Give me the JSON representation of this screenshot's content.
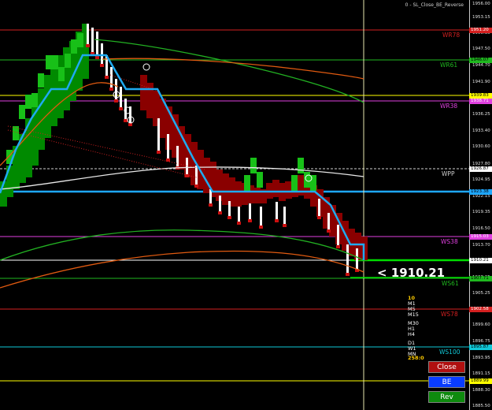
{
  "window": {
    "indicator_title": "0 - SL_Close_BE_Reverse"
  },
  "price_scale": {
    "ticks": [
      "1956.00",
      "1953.15",
      "1950.35",
      "1947.50",
      "1944.70",
      "1941.90",
      "1939.05",
      "1936.25",
      "1933.40",
      "1930.60",
      "1927.80",
      "1924.95",
      "1922.15",
      "1919.35",
      "1916.50",
      "1913.70",
      "1910.85",
      "1908.05",
      "1905.25",
      "1902.40",
      "1899.60",
      "1896.75",
      "1893.95",
      "1891.15",
      "1888.30",
      "1885.50"
    ]
  },
  "levels": [
    {
      "label": "WR78",
      "tag": "1951.20",
      "color": "#d42020",
      "tag_bg": "#d42020",
      "tag_fg": "#ffffff"
    },
    {
      "label": "WR61",
      "tag": "1946.07",
      "color": "#1fb81f",
      "tag_bg": "#1fb81f",
      "tag_fg": "#000000"
    },
    {
      "label": "",
      "tag": "1939.83",
      "color": "#ffff00",
      "tag_bg": "#ffff00",
      "tag_fg": "#000000"
    },
    {
      "label": "WR38",
      "tag": "1938.71",
      "color": "#e040e0",
      "tag_bg": "#e040e0",
      "tag_fg": "#ffffff"
    },
    {
      "label": "WPP",
      "tag": "1926.87",
      "color": "#d0d0d0",
      "tag_bg": "#ffffff",
      "tag_fg": "#000000"
    },
    {
      "label": "",
      "tag": "1923.38",
      "color": "#1ea7ff",
      "tag_bg": "#1ea7ff",
      "tag_fg": "#000000"
    },
    {
      "label": "WS38",
      "tag": "1915.03",
      "color": "#e040e0",
      "tag_bg": "#e040e0",
      "tag_fg": "#ffffff"
    },
    {
      "label": "",
      "tag": "1910.21",
      "color": "#ffffff",
      "tag_bg": "#ffffff",
      "tag_fg": "#000000"
    },
    {
      "label": "WS61",
      "tag": "1907.71",
      "color": "#1fb81f",
      "tag_bg": "#1fb81f",
      "tag_fg": "#000000"
    },
    {
      "label": "WS78",
      "tag": "1902.58",
      "color": "#d42020",
      "tag_bg": "#d42020",
      "tag_fg": "#ffffff"
    },
    {
      "label": "WS100",
      "tag": "1895.87",
      "color": "#10c8d8",
      "tag_bg": "#10c8d8",
      "tag_fg": "#000000"
    },
    {
      "label": "",
      "tag": "1889.99",
      "color": "#ffff00",
      "tag_bg": "#ffff00",
      "tag_fg": "#000000"
    }
  ],
  "current_price": {
    "text": "< 1910.21"
  },
  "timeframes": {
    "top": "10",
    "items": [
      "M1",
      "M5",
      "M15",
      "M30",
      "H1",
      "H4",
      "D1",
      "W1",
      "MN"
    ],
    "bottom": "258:0"
  },
  "buttons": {
    "close": {
      "label": "Close",
      "bg": "#b01010"
    },
    "be": {
      "label": "BE",
      "bg": "#0a3cff"
    },
    "rev": {
      "label": "Rev",
      "bg": "#0e8a0e"
    }
  },
  "colors": {
    "bull": "#008a00",
    "bull_bright": "#18c018",
    "bear": "#8a0000",
    "bear_bright": "#cc1010",
    "trend_line": "#1eaaf0",
    "ma_green": "#22b022",
    "ma_orange": "#e05a10",
    "ma_white": "#e8e8e8"
  }
}
